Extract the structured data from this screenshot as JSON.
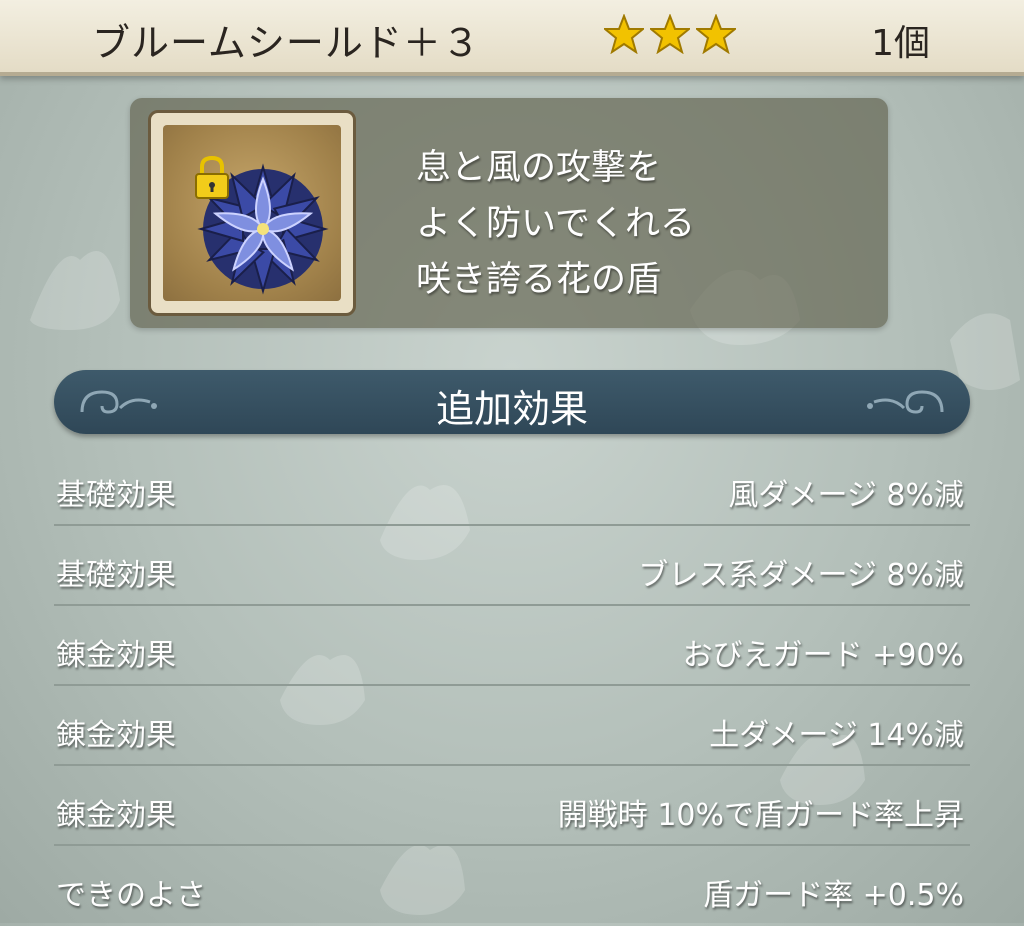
{
  "header": {
    "item_name": "ブルームシールド＋３",
    "stars": 3,
    "star_color": "#f2c200",
    "count": "1個"
  },
  "item": {
    "icon": "bloom-shield-icon",
    "locked": true,
    "description_lines": [
      "息と風の攻撃を",
      "よく防いでくれる",
      "咲き誇る花の盾"
    ]
  },
  "section": {
    "title": "追加効果"
  },
  "effects": [
    {
      "label": "基礎効果",
      "value": "風ダメージ  8%減"
    },
    {
      "label": "基礎効果",
      "value": "ブレス系ダメージ  8%減"
    },
    {
      "label": "錬金効果",
      "value": "おびえガード  +90%"
    },
    {
      "label": "錬金効果",
      "value": "土ダメージ  14%減"
    },
    {
      "label": "錬金効果",
      "value": "開戦時  10%で盾ガード率上昇"
    },
    {
      "label": "できのよさ",
      "value": "盾ガード率  +0.5%"
    }
  ]
}
